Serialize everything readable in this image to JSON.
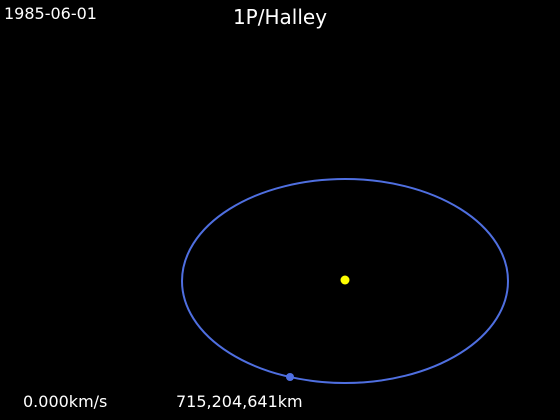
{
  "header": {
    "date": "1985-06-01",
    "title": "1P/Halley"
  },
  "footer": {
    "speed": "0.000km/s",
    "distance": "715,204,641km"
  },
  "colors": {
    "background": "#000000",
    "orbit": "#4f6fe0",
    "sun": "#ffff00",
    "comet": "#4f6fe0",
    "text": "#ffffff"
  }
}
